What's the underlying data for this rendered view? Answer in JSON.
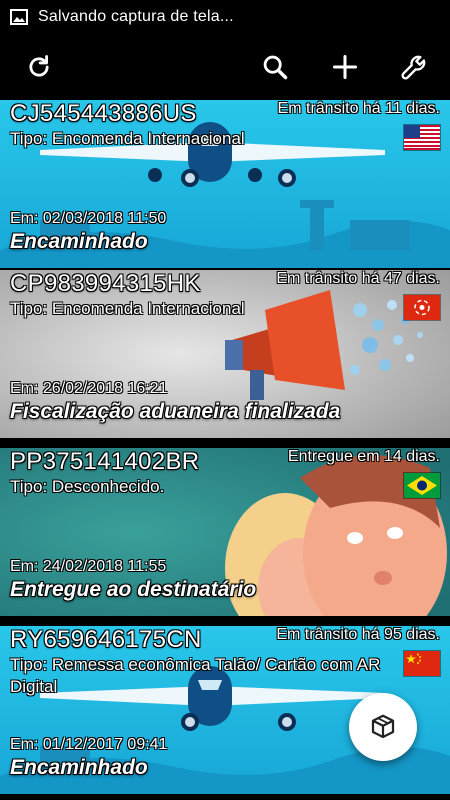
{
  "statusbar": {
    "text": "Salvando captura de tela...",
    "icon": "image-icon"
  },
  "toolbar": {
    "icons": [
      "refresh-icon",
      "search-icon",
      "add-icon",
      "settings-wrench-icon"
    ]
  },
  "packages": [
    {
      "code": "CJ545443886US",
      "days": "Em trânsito há 11 dias.",
      "tipo": "Tipo: Encomenda Internacional",
      "date": "Em: 02/03/2018 11:50",
      "status": "Encaminhado",
      "flag": "us-flag-icon",
      "background": "airplane"
    },
    {
      "code": "CP983994315HK",
      "days": "Em trânsito há 47 dias.",
      "tipo": "Tipo: Encomenda Internacional",
      "date": "Em: 26/02/2018 16:21",
      "status": "Fiscalização aduaneira finalizada",
      "flag": "hk-flag-icon",
      "background": "megaphone"
    },
    {
      "code": "PP375141402BR",
      "days": "Entregue em 14 dias.",
      "tipo": "Tipo: Desconhecido.",
      "date": "Em: 24/02/2018 11:55",
      "status": "Entregue ao destinatário",
      "flag": "br-flag-icon",
      "background": "faces"
    },
    {
      "code": "RY659646175CN",
      "days": "Em trânsito há 95 dias.",
      "tipo": "Tipo: Remessa econômica Talão/ Cartão com AR Digital",
      "date": "Em: 01/12/2017 09:41",
      "status": "Encaminhado",
      "flag": "cn-flag-icon",
      "background": "airplane"
    }
  ],
  "fab": {
    "icon": "package-box-icon"
  },
  "colors": {
    "sky": "#1cc3e6",
    "deep": "#0a2f55",
    "teal": "#2a8a8a",
    "megaphone": "#e8502a"
  }
}
